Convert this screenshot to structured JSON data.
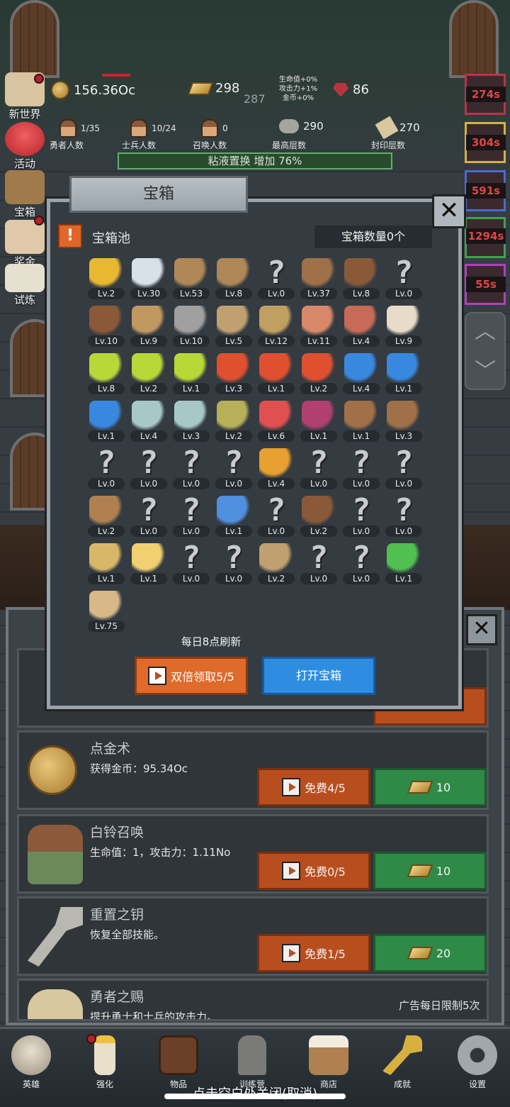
{
  "hud": {
    "coins": "156.36Oc",
    "gold": "298",
    "center_value": "287",
    "buffs": [
      "生命值+0%",
      "攻击力+1%",
      "金币+0%"
    ],
    "gems": "86",
    "heroes": {
      "value": "1/35",
      "label": "勇者人数"
    },
    "soldiers": {
      "value": "10/24",
      "label": "士兵人数"
    },
    "summons": {
      "value": "0",
      "label": "召唤人数"
    },
    "max_floor": {
      "value": "290",
      "label": "最高层数"
    },
    "seal_floor": {
      "value": "270",
      "label": "封印层数"
    },
    "slime_text": "粘液置换 增加 76%"
  },
  "left_nav": [
    {
      "label": "新世界",
      "icon": "map-icon"
    },
    {
      "label": "活动",
      "icon": "heart-icon"
    },
    {
      "label": "宝箱",
      "icon": "chest-icon"
    },
    {
      "label": "奖金",
      "icon": "envelope-icon"
    },
    {
      "label": "试炼",
      "icon": "feather-icon"
    }
  ],
  "right_buffs": [
    "274s",
    "304s",
    "591s",
    "1294s",
    "55s"
  ],
  "modal": {
    "title": "宝箱",
    "pool_title": "宝箱池",
    "chest_count": "宝箱数量0个",
    "refresh_text": "每日8点刷新",
    "double_button": "双倍领取5/5",
    "open_button": "打开宝箱",
    "items": [
      {
        "icon": "crown-icon",
        "level": "Lv.2"
      },
      {
        "icon": "diamond-icon",
        "level": "Lv.30"
      },
      {
        "icon": "sword-icon",
        "level": "Lv.53"
      },
      {
        "icon": "sword-icon",
        "level": "Lv.8"
      },
      {
        "icon": "unknown-icon",
        "level": "Lv.0"
      },
      {
        "icon": "armor-icon",
        "level": "Lv.37"
      },
      {
        "icon": "backpack-icon",
        "level": "Lv.8"
      },
      {
        "icon": "unknown-icon",
        "level": "Lv.0"
      },
      {
        "icon": "helmet-icon",
        "level": "Lv.10"
      },
      {
        "icon": "dagger-icon",
        "level": "Lv.9"
      },
      {
        "icon": "knight-helmet-icon",
        "level": "Lv.10"
      },
      {
        "icon": "hammer-icon",
        "level": "Lv.5"
      },
      {
        "icon": "great-helm-icon",
        "level": "Lv.12"
      },
      {
        "icon": "ham-icon",
        "level": "Lv.11"
      },
      {
        "icon": "steak-icon",
        "level": "Lv.4"
      },
      {
        "icon": "rice-bowl-icon",
        "level": "Lv.9"
      },
      {
        "icon": "yellow-potion-icon",
        "level": "Lv.8"
      },
      {
        "icon": "yellow-potion-icon",
        "level": "Lv.2"
      },
      {
        "icon": "yellow-potion-icon",
        "level": "Lv.1"
      },
      {
        "icon": "red-potion-icon",
        "level": "Lv.3"
      },
      {
        "icon": "red-potion-icon",
        "level": "Lv.1"
      },
      {
        "icon": "red-potion-icon",
        "level": "Lv.2"
      },
      {
        "icon": "blue-potion-icon",
        "level": "Lv.4"
      },
      {
        "icon": "blue-potion-icon",
        "level": "Lv.1"
      },
      {
        "icon": "blue-potion-icon",
        "level": "Lv.1"
      },
      {
        "icon": "bottle-icon",
        "level": "Lv.4"
      },
      {
        "icon": "bottle-icon",
        "level": "Lv.3"
      },
      {
        "icon": "wine-bottle-icon",
        "level": "Lv.2"
      },
      {
        "icon": "red-bottle-icon",
        "level": "Lv.6"
      },
      {
        "icon": "winged-boot-icon",
        "level": "Lv.1"
      },
      {
        "icon": "boot-icon",
        "level": "Lv.1"
      },
      {
        "icon": "boot-icon",
        "level": "Lv.3"
      },
      {
        "icon": "unknown-icon",
        "level": "Lv.0"
      },
      {
        "icon": "unknown-icon",
        "level": "Lv.0"
      },
      {
        "icon": "unknown-icon",
        "level": "Lv.0"
      },
      {
        "icon": "unknown-icon",
        "level": "Lv.0"
      },
      {
        "icon": "torch-icon",
        "level": "Lv.4"
      },
      {
        "icon": "unknown-icon",
        "level": "Lv.0"
      },
      {
        "icon": "unknown-icon",
        "level": "Lv.0"
      },
      {
        "icon": "unknown-icon",
        "level": "Lv.0"
      },
      {
        "icon": "staff-icon",
        "level": "Lv.2"
      },
      {
        "icon": "unknown-icon",
        "level": "Lv.0"
      },
      {
        "icon": "unknown-icon",
        "level": "Lv.0"
      },
      {
        "icon": "wand-icon",
        "level": "Lv.1"
      },
      {
        "icon": "unknown-icon",
        "level": "Lv.0"
      },
      {
        "icon": "backpack-icon",
        "level": "Lv.2"
      },
      {
        "icon": "unknown-icon",
        "level": "Lv.0"
      },
      {
        "icon": "unknown-icon",
        "level": "Lv.0"
      },
      {
        "icon": "club-icon",
        "level": "Lv.1"
      },
      {
        "icon": "cheese-icon",
        "level": "Lv.1"
      },
      {
        "icon": "unknown-icon",
        "level": "Lv.0"
      },
      {
        "icon": "unknown-icon",
        "level": "Lv.0"
      },
      {
        "icon": "bow-icon",
        "level": "Lv.2"
      },
      {
        "icon": "unknown-icon",
        "level": "Lv.0"
      },
      {
        "icon": "unknown-icon",
        "level": "Lv.0"
      },
      {
        "icon": "green-wand-icon",
        "level": "Lv.1"
      },
      {
        "icon": "beer-mug-icon",
        "level": "Lv.75"
      }
    ]
  },
  "shop": {
    "top_limit": "5次",
    "rows": [
      {
        "title": "点金术",
        "desc": "获得金币：95.34Oc",
        "free": "免费4/5",
        "price": "10",
        "icon": "coin-icon"
      },
      {
        "title": "白铃召唤",
        "desc": "生命值：1，攻击力：1.11No",
        "free": "免费0/5",
        "price": "10",
        "icon": "scarecrow-icon"
      },
      {
        "title": "重置之钥",
        "desc": "恢复全部技能。",
        "free": "免费1/5",
        "price": "20",
        "icon": "key-icon"
      },
      {
        "title": "勇者之赐",
        "desc": "提升勇士和士兵的攻击力。",
        "limit": "广告每日限制5次",
        "icon": "sack-icon"
      }
    ]
  },
  "tabs": [
    {
      "label": "英雄",
      "icon": "skull-icon"
    },
    {
      "label": "强化",
      "icon": "candle-icon"
    },
    {
      "label": "物品",
      "icon": "book-icon"
    },
    {
      "label": "训练营",
      "icon": "lantern-icon"
    },
    {
      "label": "商店",
      "icon": "mug-icon"
    },
    {
      "label": "成就",
      "icon": "key-icon"
    },
    {
      "label": "设置",
      "icon": "gear-icon"
    }
  ],
  "close_hint": "点击空白处关闭(取消)"
}
